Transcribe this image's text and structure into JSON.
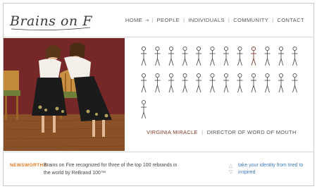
{
  "brand": {
    "logo_text": "Brains on Fire"
  },
  "nav": {
    "items": [
      {
        "label": "HOME"
      },
      {
        "label": "PEOPLE"
      },
      {
        "label": "INDIVIDUALS"
      },
      {
        "label": "COMMUNITY"
      },
      {
        "label": "CONTACT"
      }
    ]
  },
  "people_grid": {
    "total_figures": 25,
    "highlighted_index": 8
  },
  "person": {
    "name": "VIRGINIA MIRACLE",
    "title": "DIRECTOR OF WORD OF MOUTH"
  },
  "news": {
    "tag": "NEWSWORTHY:",
    "text": "Brains on Fire recognized for three of the top 100 rebrands in the world by ReBrand 100™"
  },
  "tagline": {
    "text": "take your identity from tired to inspired"
  },
  "colors": {
    "accent_orange": "#e07a1f",
    "name_red": "#8a3b2c",
    "link_blue": "#3c7cc0"
  }
}
